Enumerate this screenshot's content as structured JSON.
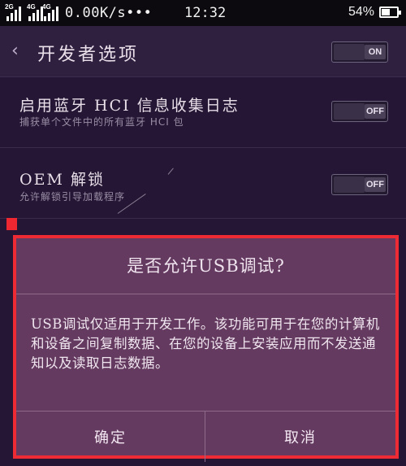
{
  "status_bar": {
    "net1": "2G",
    "net2": "4G",
    "net3": "4G",
    "speed": "0.00K/s•••",
    "time": "12:32",
    "battery_pct": "54%",
    "battery_level": 0.54
  },
  "header": {
    "back_glyph": "‹",
    "title": "开发者选项",
    "toggle_label": "ON"
  },
  "settings": [
    {
      "title": "启用蓝牙 HCI 信息收集日志",
      "subtitle": "捕获单个文件中的所有蓝牙 HCI 包",
      "toggle_label": "OFF"
    },
    {
      "title": "OEM 解锁",
      "subtitle": "允许解锁引导加载程序",
      "toggle_label": "OFF"
    }
  ],
  "dialog": {
    "title": "是否允许USB调试?",
    "body": "USB调试仅适用于开发工作。该功能可用于在您的计算机和设备之间复制数据、在您的设备上安装应用而不发送通知以及读取日志数据。",
    "ok_label": "确定",
    "cancel_label": "取消"
  },
  "colors": {
    "background": "#241634",
    "header": "#2f2040",
    "dialog": "#643a60",
    "highlight": "#ee2b35"
  }
}
